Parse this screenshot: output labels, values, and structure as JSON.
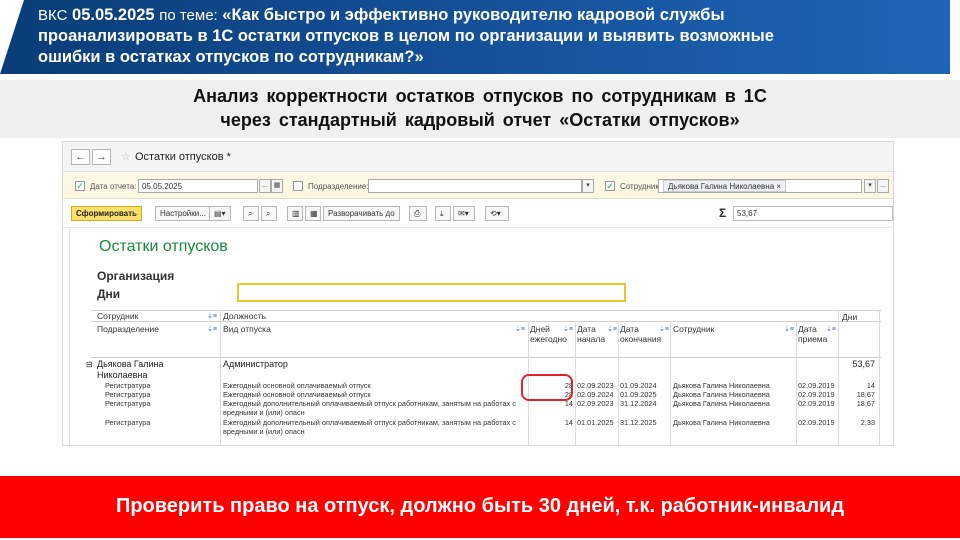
{
  "banner": {
    "vks": "ВКС",
    "date": "05.05.2025",
    "on_topic": "по теме:",
    "topic_line1": "«Как быстро и эффективно руководителю кадровой службы",
    "topic_line2": "проанализировать в 1С остатки отпусков в целом по организации и выявить возможные",
    "topic_line3": "ошибки в остатках отпусков по сотрудникам?»"
  },
  "subtitle": {
    "line1": "Анализ корректности остатков отпусков по сотрудникам в 1С",
    "line2": "через стандартный кадровый отчет «Остатки отпусков»"
  },
  "window": {
    "back": "←",
    "forward": "→",
    "star": "☆",
    "title": "Остатки отпусков *"
  },
  "filters": {
    "date_label": "Дата отчета:",
    "date_value": "05.05.2025",
    "date_checked": "✓",
    "dept_label": "Подразделение:",
    "dept_value": "",
    "employee_label": "Сотрудник:",
    "employee_value": "Дьякова Галина Николаевна",
    "employee_checked": "✓",
    "tag_close": "×",
    "dropdown": "▾",
    "calendar": "▦",
    "dots": "..."
  },
  "toolbar": {
    "generate": "Сформировать",
    "settings": "Настройки...",
    "expand": "Разворачивать до",
    "sigma": "Σ",
    "sum_value": "53,67"
  },
  "report": {
    "title": "Остатки отпусков",
    "org_label": "Организация",
    "days_label": "Дни",
    "headers": {
      "employee": "Сотрудник",
      "position": "Должность",
      "department": "Подразделение",
      "leave_type": "Вид отпуска",
      "days_per_year": "Дней ежегодно",
      "date_start": "Дата начала",
      "date_end": "Дата окончания",
      "employee2": "Сотрудник",
      "hire_date": "Дата приема",
      "days": "Дни"
    },
    "group": {
      "name_line1": "Дьякова Галина",
      "name_line2": "Николаевна",
      "position": "Администратор",
      "total": "53,67",
      "toggle": "⊟"
    },
    "rows": [
      {
        "dept": "Регистратура",
        "type": "Ежегодный основной оплачиваемый отпуск",
        "type2": "",
        "per_year": "28",
        "start": "02.09.2023",
        "end": "01.09.2024",
        "employee": "Дьякова Галина Николаевна",
        "hired": "02.09.2019",
        "days": "14"
      },
      {
        "dept": "Регистратура",
        "type": "Ежегодный основной оплачиваемый отпуск",
        "type2": "",
        "per_year": "28",
        "start": "02.09.2024",
        "end": "01.09.2025",
        "employee": "Дьякова Галина Николаевна",
        "hired": "02.09.2019",
        "days": "18,67"
      },
      {
        "dept": "Регистратура",
        "type": "Ежегодный дополнительный оплачиваемый отпуск работникам, занятым на работах с",
        "type2": "вредными и (или) опасн",
        "per_year": "14",
        "start": "02.09.2023",
        "end": "31.12.2024",
        "employee": "Дьякова Галина Николаевна",
        "hired": "02.09.2019",
        "days": "18,67"
      },
      {
        "dept": "Регистратура",
        "type": "Ежегодный дополнительный оплачиваемый отпуск работникам, занятым на работах с",
        "type2": "вредными и (или) опасн",
        "per_year": "14",
        "start": "01.01.2025",
        "end": "31.12.2025",
        "employee": "Дьякова Галина Николаевна",
        "hired": "02.09.2019",
        "days": "2,33"
      }
    ]
  },
  "footer": {
    "message": "Проверить право на отпуск, должно быть 30 дней, т.к. работник-инвалид"
  },
  "colors": {
    "banner_blue": "#0a3d78",
    "report_title_green": "#1a8a3e",
    "highlight_red": "#e0232b",
    "footer_red": "#ff0000",
    "generate_yellow": "#fbe06a"
  }
}
